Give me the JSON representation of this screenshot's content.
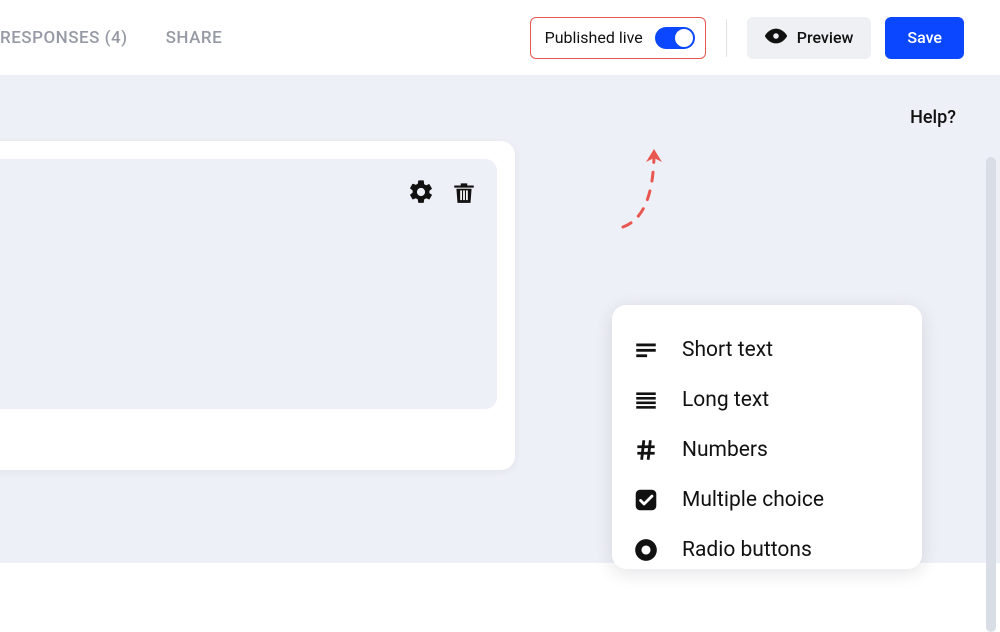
{
  "header": {
    "tabs": {
      "responses": "RESPONSES (4)",
      "share": "SHARE"
    },
    "published_label": "Published live",
    "preview_label": "Preview",
    "save_label": "Save"
  },
  "canvas": {
    "help_label": "Help?"
  },
  "field_menu": {
    "items": [
      {
        "icon": "short-text",
        "label": "Short text"
      },
      {
        "icon": "long-text",
        "label": "Long text"
      },
      {
        "icon": "numbers",
        "label": "Numbers"
      },
      {
        "icon": "multiple-choice",
        "label": "Multiple choice"
      },
      {
        "icon": "radio",
        "label": "Radio buttons"
      }
    ]
  },
  "colors": {
    "accent": "#0b47ff",
    "annotation": "#e85750",
    "canvas_bg": "#eef0f7"
  }
}
